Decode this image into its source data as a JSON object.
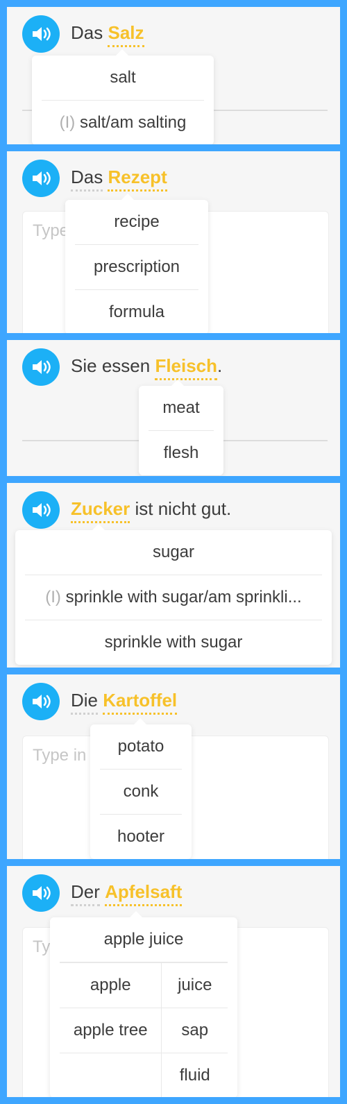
{
  "colors": {
    "frame": "#3ea6ff",
    "speaker": "#1cb0f6",
    "highlight": "#f7c12a",
    "text": "#3c3c3c"
  },
  "icons": {
    "speaker": "speaker-icon"
  },
  "cards": [
    {
      "words": [
        "Das",
        "Salz"
      ],
      "answer_placeholder": "",
      "popup": {
        "rows": [
          {
            "prefix": "",
            "text": "salt"
          },
          {
            "prefix": "(I)",
            "text": "salt/am salting"
          }
        ]
      }
    },
    {
      "words": [
        "Das",
        "Rezept"
      ],
      "answer_placeholder": "Type",
      "popup": {
        "rows": [
          {
            "prefix": "",
            "text": "recipe"
          },
          {
            "prefix": "",
            "text": "prescription"
          },
          {
            "prefix": "",
            "text": "formula"
          }
        ]
      }
    },
    {
      "words": [
        "Sie",
        "essen",
        "Fleisch",
        "."
      ],
      "answer_placeholder": "",
      "popup": {
        "rows": [
          {
            "prefix": "",
            "text": "meat"
          },
          {
            "prefix": "",
            "text": "flesh"
          }
        ]
      }
    },
    {
      "words": [
        "Zucker",
        "ist nicht gut."
      ],
      "answer_placeholder": "",
      "popup": {
        "rows": [
          {
            "prefix": "",
            "text": "sugar"
          },
          {
            "prefix": "(I)",
            "text": "sprinkle with sugar/am sprinkli..."
          },
          {
            "prefix": "",
            "text": "sprinkle with sugar"
          }
        ]
      }
    },
    {
      "words": [
        "Die",
        "Kartoffel"
      ],
      "answer_placeholder": "Type in",
      "popup": {
        "rows": [
          {
            "prefix": "",
            "text": "potato"
          },
          {
            "prefix": "",
            "text": "conk"
          },
          {
            "prefix": "",
            "text": "hooter"
          }
        ]
      }
    },
    {
      "words": [
        "Der",
        "Apfelsaft"
      ],
      "answer_placeholder": "Ty",
      "popup": {
        "rows": [
          {
            "prefix": "",
            "text": "apple juice"
          }
        ],
        "grid": {
          "left": [
            "apple",
            "apple tree",
            ""
          ],
          "right": [
            "juice",
            "sap",
            "fluid"
          ]
        }
      }
    }
  ]
}
